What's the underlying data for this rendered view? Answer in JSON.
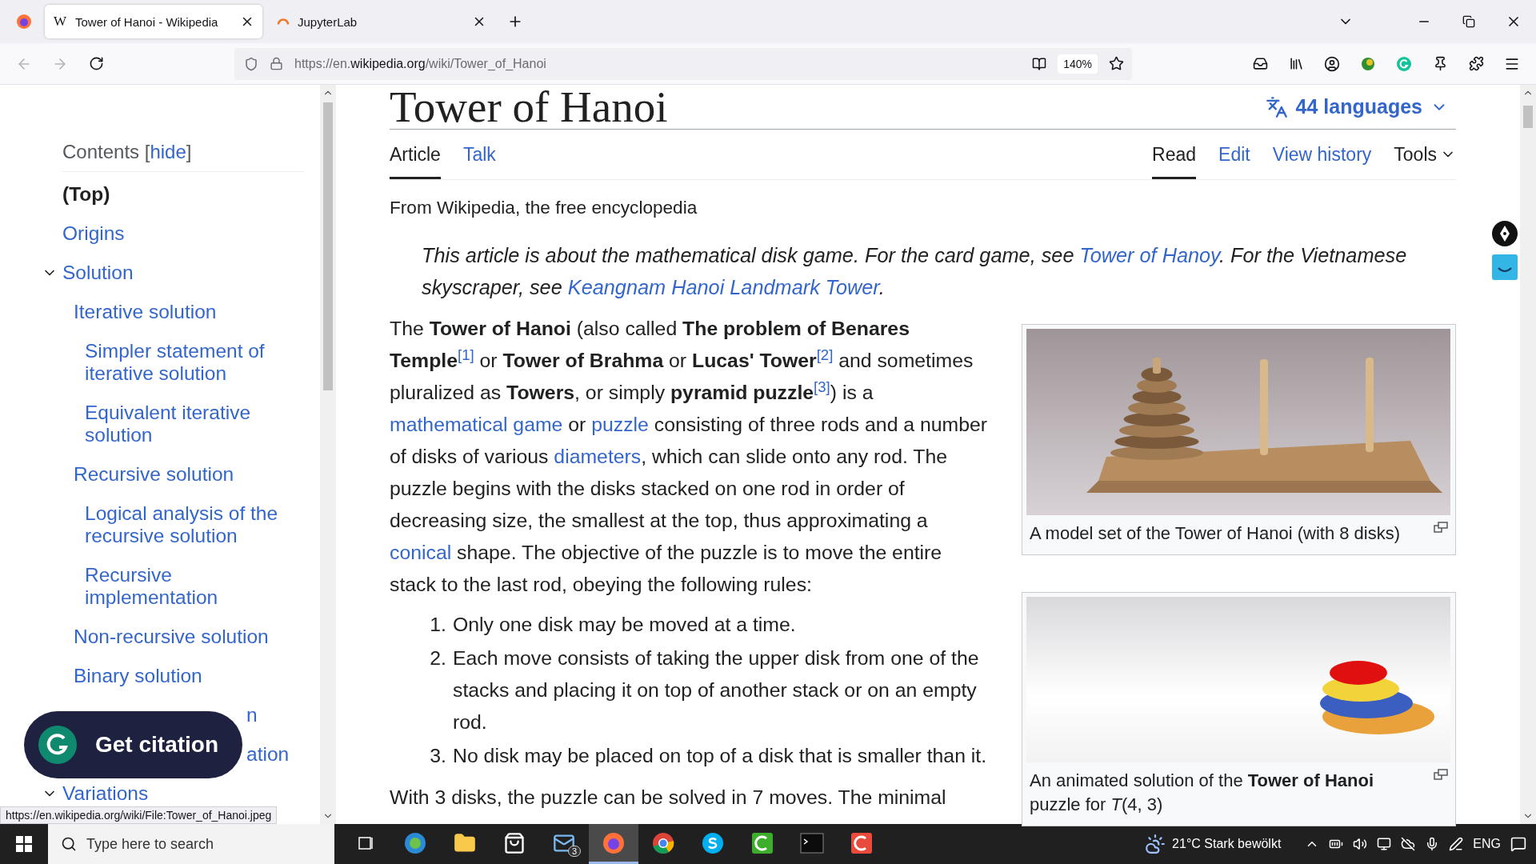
{
  "browser": {
    "tabs": [
      {
        "kind": "wikipedia",
        "favicon": "W",
        "title": "Tower of Hanoi - Wikipedia",
        "selected": true
      },
      {
        "kind": "jupyter",
        "title": "JupyterLab",
        "selected": false
      }
    ],
    "back": {
      "disabled": true
    },
    "forward": {
      "disabled": true
    },
    "url": {
      "scheme": "https://en.",
      "domain": "wikipedia.org",
      "path": "/wiki/Tower_of_Hanoi"
    },
    "zoom": "140%",
    "status_url": "https://en.wikipedia.org/wiki/File:Tower_of_Hanoi.jpeg"
  },
  "sidebar": {
    "heading": "Contents",
    "toggle_brackets": [
      "[",
      "]"
    ],
    "toggle": "hide",
    "items": [
      {
        "kind": "link",
        "label": "(Top)",
        "selected": true
      },
      {
        "kind": "link",
        "label": "Origins",
        "selected": false
      },
      {
        "kind": "link",
        "label": "Solution",
        "selected": false,
        "expanded": true,
        "children": [
          {
            "kind": "link",
            "label": "Iterative solution",
            "selected": false,
            "children": [
              {
                "kind": "link",
                "label": "Simpler statement of iterative solution",
                "selected": false
              },
              {
                "kind": "link",
                "label": "Equivalent iterative solution",
                "selected": false
              }
            ]
          },
          {
            "kind": "link",
            "label": "Recursive solution",
            "selected": false,
            "children": [
              {
                "kind": "link",
                "label": "Logical analysis of the recursive solution",
                "selected": false
              },
              {
                "kind": "link",
                "label": "Recursive implementation",
                "selected": false
              }
            ]
          },
          {
            "kind": "link",
            "label": "Non-recursive solution",
            "selected": false
          },
          {
            "kind": "link",
            "label": "Binary solution",
            "selected": false
          },
          {
            "kind": "covered",
            "label": "n",
            "selected": false
          },
          {
            "kind": "covered",
            "label": "ation",
            "selected": false
          }
        ]
      },
      {
        "kind": "link",
        "label": "Variations",
        "selected": false,
        "expanded": true
      }
    ],
    "citation_button": "Get citation"
  },
  "article": {
    "title": "Tower of Hanoi",
    "languages": "44 languages",
    "tabs": [
      {
        "label": "Article",
        "selected": true
      },
      {
        "label": "Talk",
        "selected": false
      }
    ],
    "views": [
      {
        "label": "Read",
        "selected": true
      },
      {
        "label": "Edit",
        "selected": false
      },
      {
        "label": "View history",
        "selected": false
      }
    ],
    "tools": "Tools",
    "tagline": "From Wikipedia, the free encyclopedia",
    "hatnote": [
      {
        "kind": "plain",
        "text": "This article is about the mathematical disk game. For the card game, see "
      },
      {
        "kind": "link",
        "text": "Tower of Hanoy"
      },
      {
        "kind": "plain",
        "text": ". For the Vietnamese skyscraper, see "
      },
      {
        "kind": "link",
        "text": "Keangnam Hanoi Landmark Tower"
      },
      {
        "kind": "plain",
        "text": "."
      }
    ],
    "lead": [
      {
        "kind": "plain",
        "text": "The "
      },
      {
        "kind": "bold",
        "text": "Tower of Hanoi"
      },
      {
        "kind": "plain",
        "text": " (also called "
      },
      {
        "kind": "bold",
        "text": "The problem of Benares Temple"
      },
      {
        "kind": "ref",
        "text": "[1]"
      },
      {
        "kind": "plain",
        "text": " or "
      },
      {
        "kind": "bold",
        "text": "Tower of Brahma"
      },
      {
        "kind": "plain",
        "text": " or "
      },
      {
        "kind": "bold",
        "text": "Lucas' Tower"
      },
      {
        "kind": "ref",
        "text": "[2]"
      },
      {
        "kind": "plain",
        "text": " and sometimes pluralized as "
      },
      {
        "kind": "bold",
        "text": "Towers"
      },
      {
        "kind": "plain",
        "text": ", or simply "
      },
      {
        "kind": "bold",
        "text": "pyramid puzzle"
      },
      {
        "kind": "ref",
        "text": "[3]"
      },
      {
        "kind": "plain",
        "text": ") is a "
      },
      {
        "kind": "link",
        "text": "mathematical game"
      },
      {
        "kind": "plain",
        "text": " or "
      },
      {
        "kind": "link",
        "text": "puzzle"
      },
      {
        "kind": "plain",
        "text": " consisting of three rods and a number of disks of various "
      },
      {
        "kind": "link",
        "text": "diameters"
      },
      {
        "kind": "plain",
        "text": ", which can slide onto any rod. The puzzle begins with the disks stacked on one rod in order of decreasing size, the smallest at the top, thus approximating a "
      },
      {
        "kind": "link",
        "text": "conical"
      },
      {
        "kind": "plain",
        "text": " shape. The objective of the puzzle is to move the entire stack to the last rod, obeying the following rules:"
      }
    ],
    "rules": [
      {
        "marker": "1.",
        "text": "Only one disk may be moved at a time."
      },
      {
        "marker": "2.",
        "text": "Each move consists of taking the upper disk from one of the stacks and placing it on top of another stack or on an empty rod."
      },
      {
        "marker": "3.",
        "text": "No disk may be placed on top of a disk that is smaller than it."
      }
    ],
    "after": "With 3 disks, the puzzle can be solved in 7 moves. The minimal",
    "figures": [
      {
        "kind": "wooden",
        "caption": "A model set of the Tower of Hanoi (with 8 disks)"
      },
      {
        "kind": "colored",
        "caption": "An animated solution of the **Tower of Hanoi** puzzle for *T*(4, 3)"
      }
    ]
  },
  "taskbar": {
    "search": {
      "placeholder": "Type here to search"
    },
    "apps": [
      {
        "kind": "taskview",
        "selected": false
      },
      {
        "kind": "edge",
        "selected": false
      },
      {
        "kind": "folder",
        "selected": false
      },
      {
        "kind": "store",
        "selected": false
      },
      {
        "kind": "mail",
        "badge": "3",
        "selected": false
      },
      {
        "kind": "firefox",
        "selected": true
      },
      {
        "kind": "chrome",
        "selected": false
      },
      {
        "kind": "skype",
        "selected": false
      },
      {
        "kind": "recorder-green",
        "selected": false
      },
      {
        "kind": "terminal",
        "selected": false
      },
      {
        "kind": "recorder-red",
        "selected": false
      }
    ],
    "weather": "21°C Stark bewölkt",
    "language": "ENG"
  }
}
